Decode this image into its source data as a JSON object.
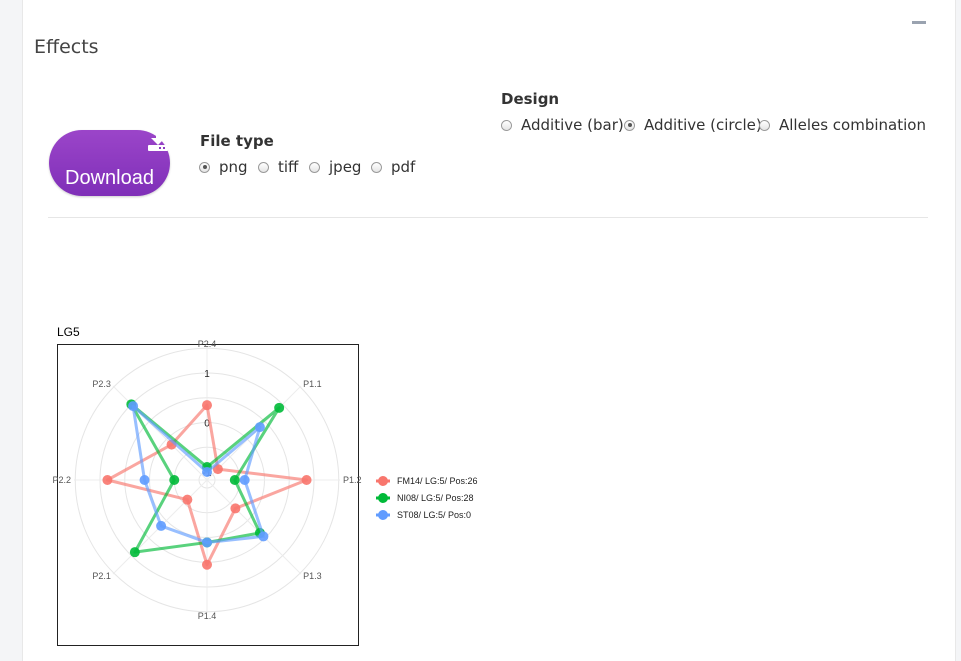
{
  "box": {
    "title": "Effects"
  },
  "download": {
    "label": "Download",
    "icon": "download-icon"
  },
  "file_type": {
    "label": "File type",
    "options": [
      "png",
      "tiff",
      "jpeg",
      "pdf"
    ],
    "selected": "png"
  },
  "design": {
    "label": "Design",
    "options": [
      "Additive (bar)",
      "Additive (circle)",
      "Alleles combination"
    ],
    "selected": "Additive (circle)"
  },
  "chart_data": {
    "type": "radar",
    "title": "LG5",
    "axes": [
      "P1.1",
      "P1.2",
      "P1.3",
      "P1.4",
      "P2.1",
      "P2.2",
      "P2.3",
      "P2.4"
    ],
    "radial_ticks": [
      "-1",
      "0",
      "1"
    ],
    "rlim": [
      -1,
      1
    ],
    "series": [
      {
        "name": "FM14/ LG:5/ Pos:26",
        "color": "#f8766d",
        "values": [
          -0.85,
          0.85,
          -0.35,
          0.55,
          -0.6,
          0.85,
          -0.15,
          0.35
        ]
      },
      {
        "name": "NI08/ LG:5/ Pos:28",
        "color": "#00ba38",
        "values": [
          0.9,
          -0.6,
          0.35,
          0.1,
          0.9,
          -0.5,
          1.0,
          -0.9
        ]
      },
      {
        "name": "ST08/ LG:5/ Pos:0",
        "color": "#619cff",
        "values": [
          0.35,
          -0.4,
          0.45,
          0.1,
          0.15,
          0.1,
          0.95,
          -1.0
        ]
      }
    ],
    "legend_position": "right"
  }
}
